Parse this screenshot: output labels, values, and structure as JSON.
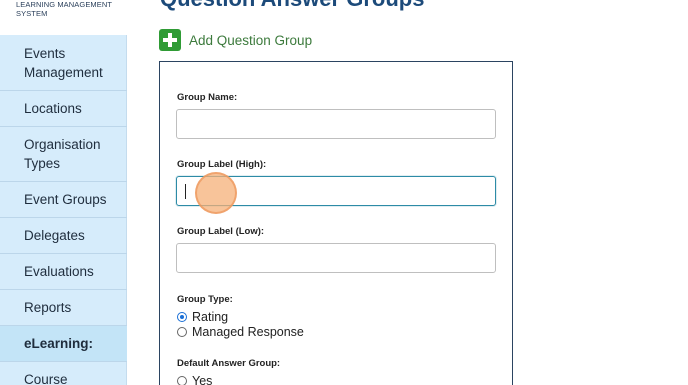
{
  "logo": {
    "line1": "LEARNING MANAGEMENT",
    "line2": "SYSTEM"
  },
  "page_title": "Question Answer Groups",
  "sidebar": {
    "items": [
      {
        "label": "Events Management",
        "section": false
      },
      {
        "label": "Locations",
        "section": false
      },
      {
        "label": "Organisation Types",
        "section": false
      },
      {
        "label": "Event Groups",
        "section": false
      },
      {
        "label": "Delegates",
        "section": false
      },
      {
        "label": "Evaluations",
        "section": false
      },
      {
        "label": "Reports",
        "section": false
      },
      {
        "label": "eLearning:",
        "section": true
      },
      {
        "label": "Course",
        "section": false
      }
    ]
  },
  "add_group": {
    "label": "Add Question Group",
    "icon": "plus-icon"
  },
  "form": {
    "group_name": {
      "label": "Group Name:",
      "value": ""
    },
    "group_label_high": {
      "label": "Group Label (High):",
      "value": ""
    },
    "group_label_low": {
      "label": "Group Label (Low):",
      "value": ""
    },
    "group_type": {
      "label": "Group Type:",
      "options": [
        {
          "label": "Rating",
          "checked": true
        },
        {
          "label": "Managed Response",
          "checked": false
        }
      ]
    },
    "default_answer_group": {
      "label": "Default Answer Group:",
      "options": [
        {
          "label": "Yes",
          "checked": false
        }
      ]
    }
  },
  "colors": {
    "sidebar_bg": "#d6ecfb",
    "title": "#1c4a7a",
    "add_icon": "#2f9b35",
    "focus_border": "#2d8ba6",
    "radio_checked": "#1a6fd6"
  }
}
